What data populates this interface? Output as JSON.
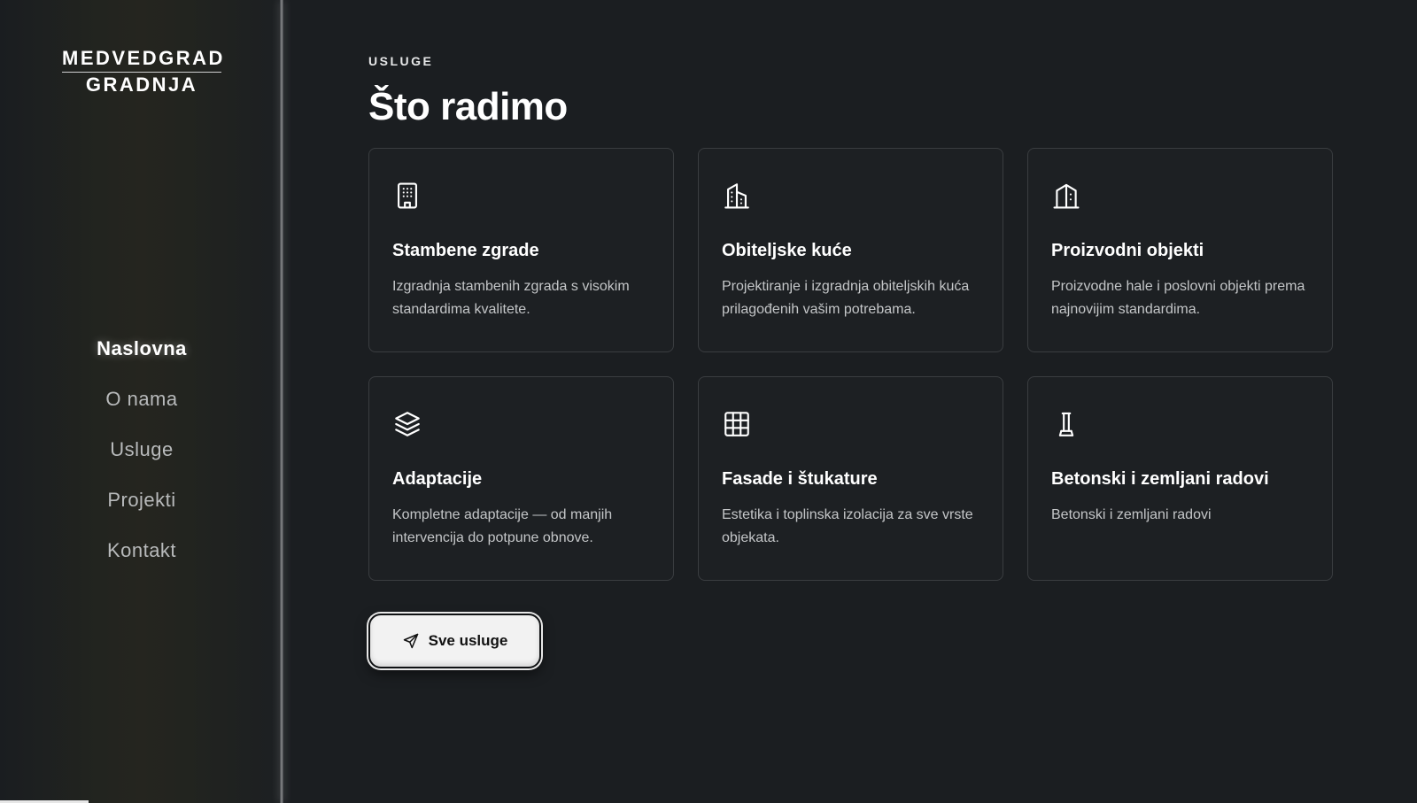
{
  "logo": {
    "line1": "MEDVEDGRAD",
    "line2": "GRADNJA"
  },
  "nav": {
    "items": [
      {
        "label": "Naslovna",
        "active": true
      },
      {
        "label": "O nama",
        "active": false
      },
      {
        "label": "Usluge",
        "active": false
      },
      {
        "label": "Projekti",
        "active": false
      },
      {
        "label": "Kontakt",
        "active": false
      }
    ]
  },
  "section": {
    "eyebrow": "USLUGE",
    "title": "Što radimo"
  },
  "services": [
    {
      "icon": "building-icon",
      "title": "Stambene zgrade",
      "description": "Izgradnja stambenih zgrada s visokim standardima kvalitete."
    },
    {
      "icon": "houses-icon",
      "title": "Obiteljske kuće",
      "description": "Projektiranje i izgradnja obiteljskih kuća prilagođenih vašim potrebama."
    },
    {
      "icon": "factory-icon",
      "title": "Proizvodni objekti",
      "description": "Proizvodne hale i poslovni objekti prema najnovijim standardima."
    },
    {
      "icon": "layers-icon",
      "title": "Adaptacije",
      "description": "Kompletne adaptacije — od manjih intervencija do potpune obnove."
    },
    {
      "icon": "grid-icon",
      "title": "Fasade i štukature",
      "description": "Estetika i toplinska izolacija za sve vrste objekata."
    },
    {
      "icon": "pillar-icon",
      "title": "Betonski i zemljani radovi",
      "description": "Betonski i zemljani radovi"
    }
  ],
  "cta": {
    "label": "Sve usluge",
    "icon": "send-icon"
  },
  "colors": {
    "background": "#1b1e21",
    "card_border": "#3a3d40",
    "button_bg": "#f2f2f2"
  }
}
